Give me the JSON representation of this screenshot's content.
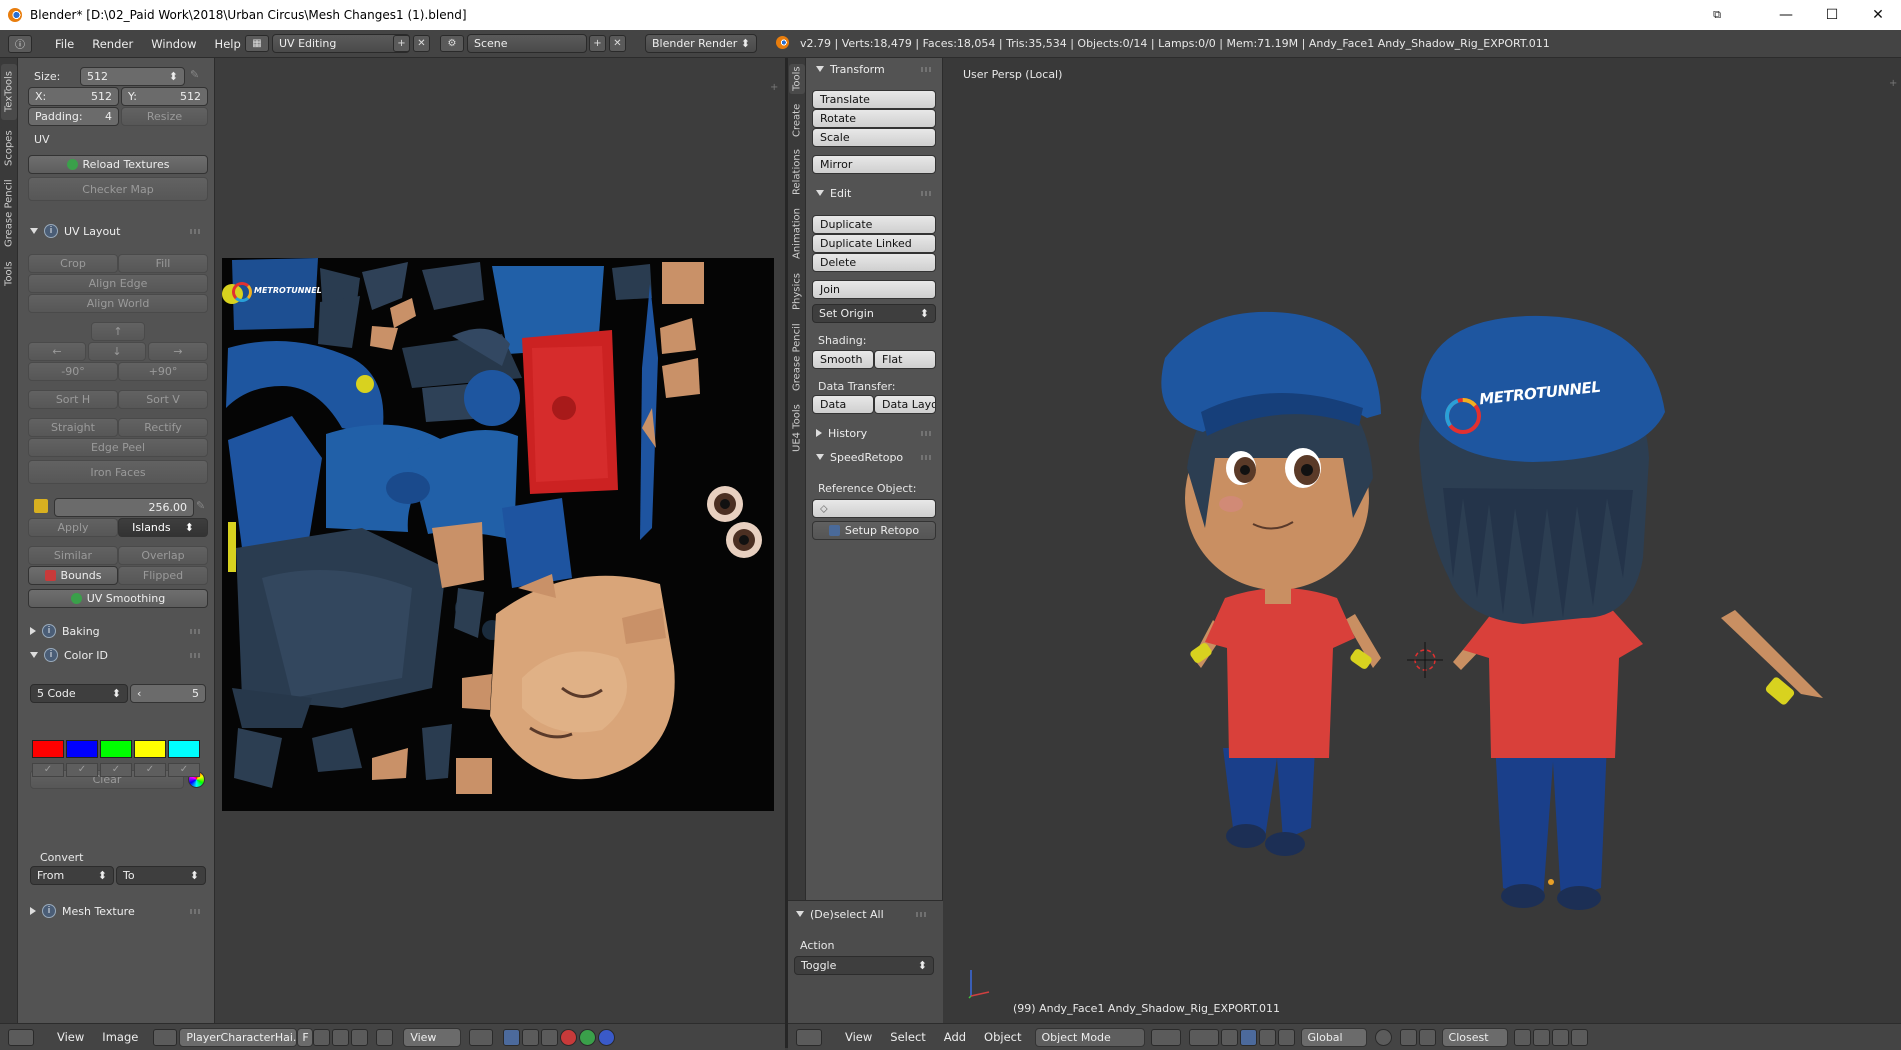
{
  "window": {
    "title": "Blender* [D:\\02_Paid Work\\2018\\Urban Circus\\Mesh Changes1 (1).blend]",
    "minimize": "—",
    "maximize": "☐",
    "close": "✕"
  },
  "menubar": {
    "items": [
      "File",
      "Render",
      "Window",
      "Help"
    ],
    "screen_layout": "UV Editing",
    "scene": "Scene",
    "render_engine": "Blender Render",
    "stats": "v2.79 | Verts:18,479 | Faces:18,054 | Tris:35,534 | Objects:0/14 | Lamps:0/0 | Mem:71.19M | Andy_Face1 Andy_Shadow_Rig_EXPORT.011"
  },
  "left_tabs": [
    "TexTools",
    "Scopes",
    "Grease Pencil",
    "Tools"
  ],
  "texture_size": {
    "size_label": "Size:",
    "size_value": "512",
    "x_label": "X:",
    "x_value": "512",
    "y_label": "Y:",
    "y_value": "512",
    "padding_label": "Padding:",
    "padding_value": "4",
    "resize": "Resize"
  },
  "uv_section": {
    "label": "UV",
    "reload_textures": "Reload Textures",
    "checker_map": "Checker Map"
  },
  "uv_layout": {
    "title": "UV Layout",
    "crop": "Crop",
    "fill": "Fill",
    "align_edge": "Align Edge",
    "align_world": "Align World",
    "arrow_up": "↑",
    "arrow_left": "←",
    "arrow_down": "↓",
    "arrow_right": "→",
    "rot_minus": "-90°",
    "rot_plus": "+90°",
    "sort_h": "Sort H",
    "sort_v": "Sort V",
    "straight": "Straight",
    "rectify": "Rectify",
    "edge_peel": "Edge Peel",
    "iron_faces": "Iron Faces",
    "texel_value": "256.00",
    "apply": "Apply",
    "islands": "Islands",
    "similar": "Similar",
    "overlap": "Overlap",
    "bounds": "Bounds",
    "flipped": "Flipped",
    "uv_smoothing": "UV Smoothing"
  },
  "baking": {
    "title": "Baking"
  },
  "color_id": {
    "title": "Color ID",
    "code": "5 Code",
    "count": "5",
    "clear": "Clear",
    "swatches": [
      "#ff0000",
      "#0000ff",
      "#00ff00",
      "#ffff00",
      "#00ffff"
    ],
    "check": "✓",
    "convert_label": "Convert",
    "from": "From",
    "to": "To"
  },
  "mesh_texture": {
    "title": "Mesh Texture"
  },
  "uv_texture": {
    "logo_text": "METROTUNNEL"
  },
  "right_tabs": [
    "Tools",
    "Create",
    "Relations",
    "Animation",
    "Physics",
    "Grease Pencil",
    "UE4 Tools"
  ],
  "transform": {
    "title": "Transform",
    "translate": "Translate",
    "rotate": "Rotate",
    "scale": "Scale",
    "mirror": "Mirror"
  },
  "edit": {
    "title": "Edit",
    "duplicate": "Duplicate",
    "duplicate_linked": "Duplicate Linked",
    "delete": "Delete",
    "join": "Join",
    "set_origin": "Set Origin",
    "shading_label": "Shading:",
    "smooth": "Smooth",
    "flat": "Flat",
    "data_transfer_label": "Data Transfer:",
    "data": "Data",
    "data_layo": "Data Layo"
  },
  "history": {
    "title": "History"
  },
  "speedretopo": {
    "title": "SpeedRetopo",
    "reference_object": "Reference Object:",
    "setup_retopo": "Setup Retopo"
  },
  "deselect_all": {
    "title": "(De)select All",
    "action_label": "Action",
    "action_value": "Toggle"
  },
  "viewport": {
    "view_label": "User Persp (Local)",
    "object_info": "(99) Andy_Face1 Andy_Shadow_Rig_EXPORT.011",
    "cap_text": "METROTUNNEL"
  },
  "uv_footer": {
    "view": "View",
    "image": "Image",
    "image_name": "PlayerCharacterHai...",
    "f_label": "F",
    "view_btn": "View"
  },
  "viewport_footer": {
    "view": "View",
    "select": "Select",
    "add": "Add",
    "object": "Object",
    "mode": "Object Mode",
    "orientation": "Global",
    "snap": "Closest"
  },
  "colors": {
    "hat_blue": "#1e56a0",
    "shirt_red": "#d9403a",
    "skin": "#c98f62",
    "hair": "#2c3e52",
    "pants": "#1a3f8a",
    "wrist_yellow": "#d8d21f"
  }
}
